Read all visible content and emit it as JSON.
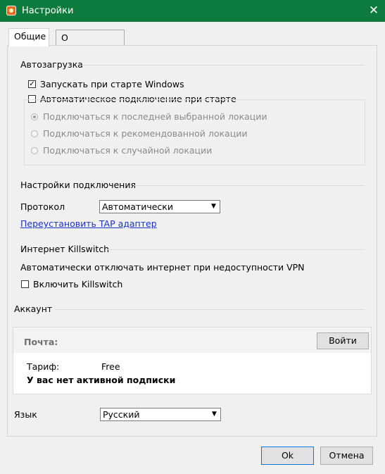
{
  "window": {
    "title": "Настройки",
    "close": "✕"
  },
  "tabs": [
    {
      "label": "Общие"
    },
    {
      "label": "О программе"
    }
  ],
  "autostart": {
    "title": "Автозагрузка",
    "launch_windows": {
      "label": "Запускать при старте Windows",
      "checked": true
    },
    "auto_connect": {
      "label": "Автоматическое подключение при старте",
      "checked": false
    },
    "options": [
      {
        "label": "Подключаться к последней выбранной локации",
        "selected": true
      },
      {
        "label": "Подключаться к рекомендованной локации",
        "selected": false
      },
      {
        "label": "Подключаться к случайной локации",
        "selected": false
      }
    ]
  },
  "connection": {
    "title": "Настройки подключения",
    "protocol_label": "Протокол",
    "protocol_value": "Автоматически",
    "reinstall_link": "Переустановить TAP адаптер"
  },
  "killswitch": {
    "title": "Интернет Killswitch",
    "description": "Автоматически отключать интернет при недоступности VPN",
    "enable": {
      "label": "Включить Killswitch",
      "checked": false
    }
  },
  "account": {
    "title": "Аккаунт",
    "email_label": "Почта:",
    "login_button": "Войти",
    "tariff_label": "Тариф:",
    "tariff_value": "Free",
    "subscription_status": "У вас нет активной подписки"
  },
  "language": {
    "label": "Язык",
    "value": "Русский"
  },
  "footer": {
    "ok": "Ok",
    "cancel": "Отмена"
  },
  "colors": {
    "titlebar": "#0d7a3e",
    "link": "#1a32c8",
    "button_focus": "#0078d7"
  },
  "icons": {
    "app": "app-logo-icon",
    "close": "close-icon",
    "dropdown": "chevron-down-icon",
    "check": "checkmark-icon"
  }
}
